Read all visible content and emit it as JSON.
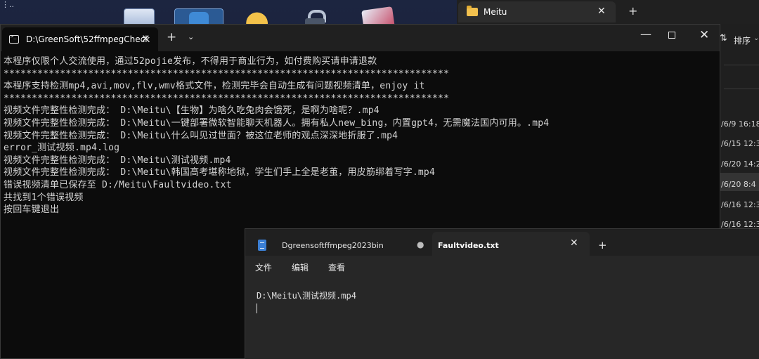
{
  "desktop": {
    "corner_text": "⋮.."
  },
  "explorer": {
    "tab_label": "Meitu",
    "tab_close": "✕",
    "new_tab": "+",
    "sort_icon": "⇅",
    "sort_label": "排序",
    "sort_chevron": "⌄",
    "dates": [
      "/6/9 16:18",
      "/6/15 12:3",
      "/6/20 14:2",
      "/6/20 8:4",
      "/6/16 12:3",
      "/6/16 12:3"
    ]
  },
  "terminal": {
    "tab_label": "D:\\GreenSoft\\52ffmpegCheck",
    "tab_close": "✕",
    "new_tab": "+",
    "dropdown": "⌄",
    "minimize": "—",
    "close": "✕",
    "lines": [
      "本程序仅限个人交流使用，通过52pojie发布，不得用于商业行为，如付费购买请申请退款",
      "*******************************************************************************",
      "本程序支持检测mp4,avi,mov,flv,wmv格式文件，检测完毕会自动生成有问题视频清单，enjoy it",
      "*******************************************************************************",
      "视频文件完整性检测完成： D:\\Meitu\\【生物】为啥久吃兔肉会饿死，是啊为啥呢？.mp4",
      "视频文件完整性检测完成： D:\\Meitu\\一键部署微软智能聊天机器人。拥有私人new_bing，内置gpt4，无需魔法国内可用。.mp4",
      "视频文件完整性检测完成： D:\\Meitu\\什么叫见过世面？被这位老师的观点深深地折服了.mp4",
      "error_测试视频.mp4.log",
      "视频文件完整性检测完成： D:\\Meitu\\测试视频.mp4",
      "视频文件完整性检测完成： D:\\Meitu\\韩国高考堪称地狱，学生们手上全是老茧，用皮筋绑着写字.mp4",
      "错误视频清单已保存至 D:/Meitu\\Faultvideo.txt",
      "共找到1个错误视频",
      "按回车键退出"
    ]
  },
  "notepad": {
    "tab1_label": "Dgreensoftffmpeg2023bin",
    "tab1_dot": "●",
    "tab2_label": "Faultvideo.txt",
    "tab2_close": "✕",
    "new_tab": "+",
    "menu": [
      "文件",
      "编辑",
      "查看"
    ],
    "content": "D:\\Meitu\\测试视频.mp4"
  }
}
